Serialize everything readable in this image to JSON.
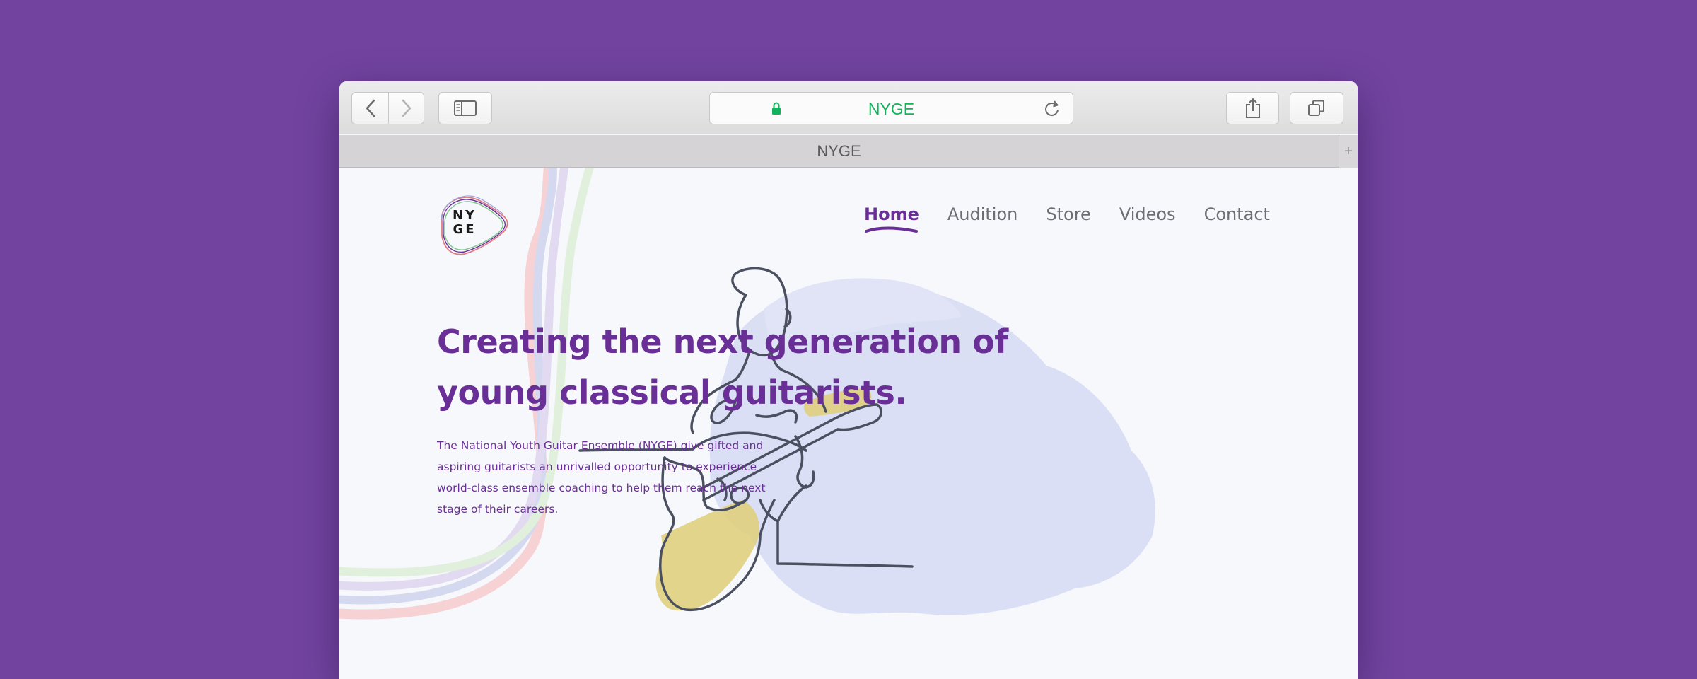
{
  "browser": {
    "address": "NYGE",
    "tab_title": "NYGE",
    "new_tab_label": "+"
  },
  "site": {
    "logo_text": "NY\nGE",
    "nav": [
      {
        "label": "Home",
        "active": true
      },
      {
        "label": "Audition",
        "active": false
      },
      {
        "label": "Store",
        "active": false
      },
      {
        "label": "Videos",
        "active": false
      },
      {
        "label": "Contact",
        "active": false
      }
    ],
    "headline": "Creating the next generation of young classical guitarists.",
    "intro": "The National Youth Guitar Ensemble (NYGE) give gifted and aspiring guitarists an unrivalled opportunity to experience world-class ensemble coaching to help them reach the next stage of their careers."
  },
  "colors": {
    "background": "#7244a0",
    "brand_purple": "#6a2f97",
    "secure_green": "#12b35a",
    "wash_blue": "#d6dbf3",
    "guitar_yellow": "#e0cf7e"
  }
}
